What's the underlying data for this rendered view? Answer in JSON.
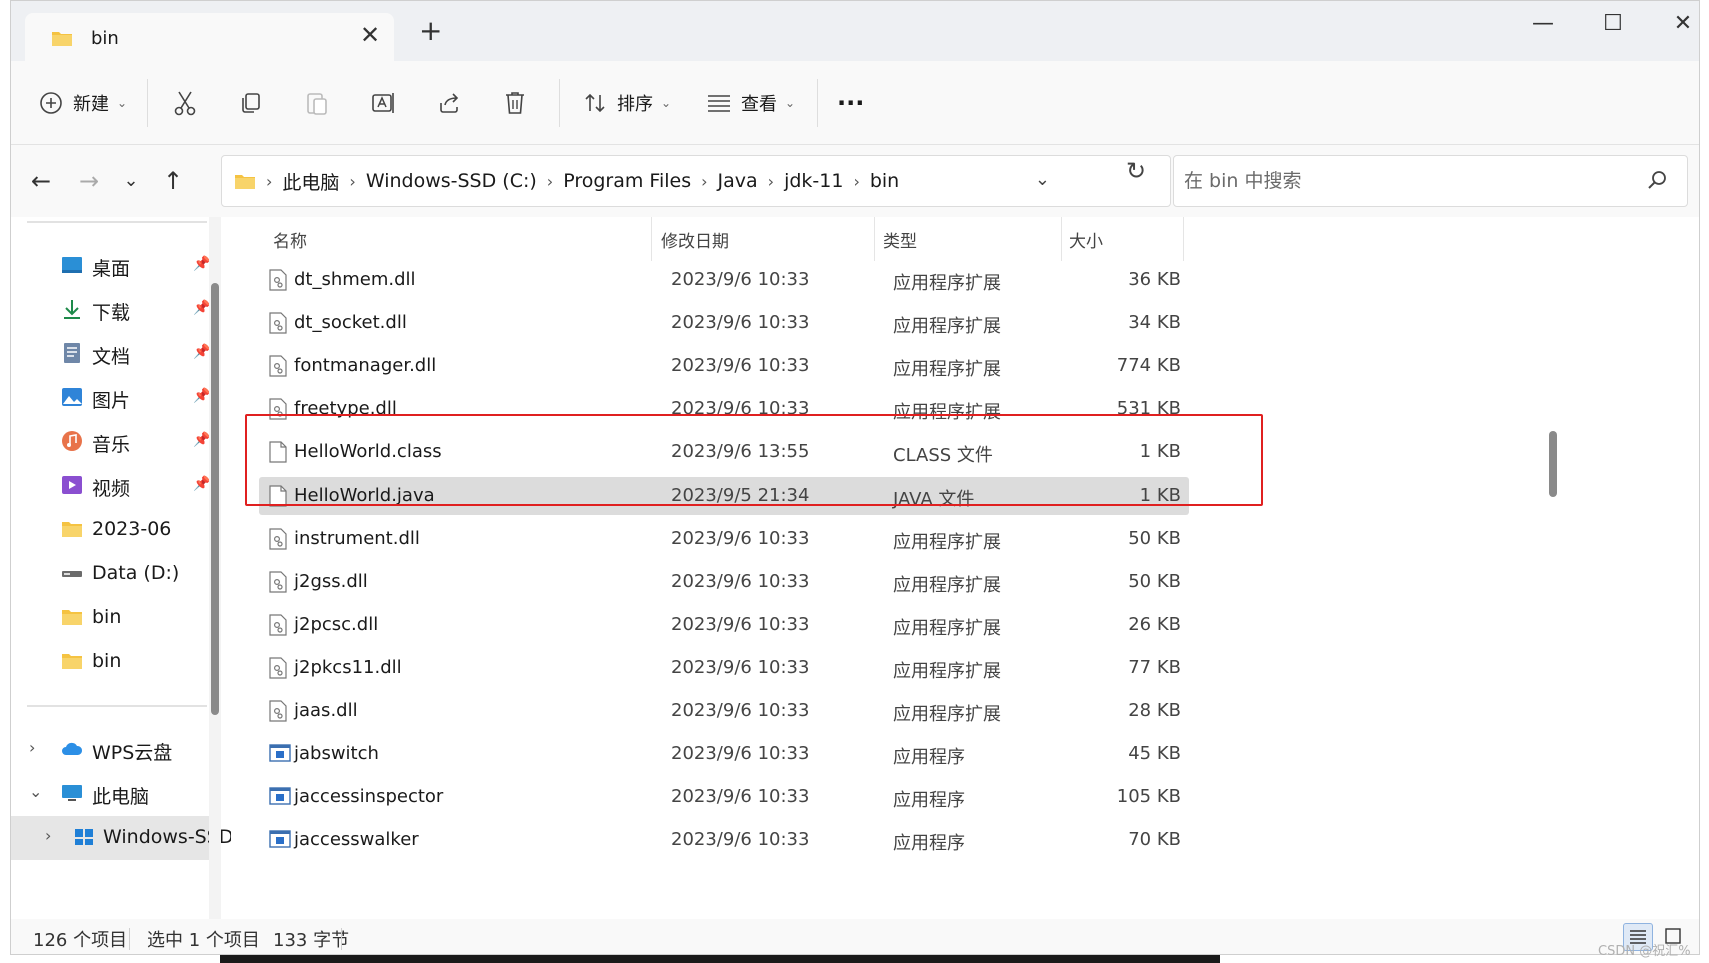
{
  "window": {
    "tab_title": "bin",
    "tab_close": "✕",
    "new_tab": "+",
    "minimize": "—",
    "maximize": "☐",
    "close": "✕"
  },
  "toolbar": {
    "new_label": "新建",
    "sort_label": "排序",
    "view_label": "查看",
    "more": "···"
  },
  "address": {
    "crumbs": [
      "此电脑",
      "Windows-SSD (C:)",
      "Program Files",
      "Java",
      "jdk-11",
      "bin"
    ],
    "search_placeholder": "在 bin 中搜索"
  },
  "sidebar": {
    "quick": [
      {
        "label": "桌面",
        "icon": "desktop-icon",
        "pinned": true
      },
      {
        "label": "下载",
        "icon": "download-icon",
        "pinned": true
      },
      {
        "label": "文档",
        "icon": "document-icon",
        "pinned": true
      },
      {
        "label": "图片",
        "icon": "picture-icon",
        "pinned": true
      },
      {
        "label": "音乐",
        "icon": "music-icon",
        "pinned": true
      },
      {
        "label": "视频",
        "icon": "video-icon",
        "pinned": true
      },
      {
        "label": "2023-06",
        "icon": "folder-icon",
        "pinned": false
      },
      {
        "label": "Data (D:)",
        "icon": "drive-icon",
        "pinned": false
      },
      {
        "label": "bin",
        "icon": "folder-icon",
        "pinned": false
      },
      {
        "label": "bin",
        "icon": "folder-icon",
        "pinned": false
      }
    ],
    "tree": [
      {
        "label": "WPS云盘",
        "icon": "cloud-icon",
        "expander": "›"
      },
      {
        "label": "此电脑",
        "icon": "computer-icon",
        "expander": "⌄"
      },
      {
        "label": "Windows-SSD",
        "icon": "windows-drive-icon",
        "expander": "›"
      }
    ]
  },
  "columns": {
    "name": "名称",
    "date": "修改日期",
    "type": "类型",
    "size": "大小"
  },
  "files": [
    {
      "name": "dt_shmem.dll",
      "date": "2023/9/6 10:33",
      "type": "应用程序扩展",
      "size": "36 KB",
      "kind": "dll"
    },
    {
      "name": "dt_socket.dll",
      "date": "2023/9/6 10:33",
      "type": "应用程序扩展",
      "size": "34 KB",
      "kind": "dll"
    },
    {
      "name": "fontmanager.dll",
      "date": "2023/9/6 10:33",
      "type": "应用程序扩展",
      "size": "774 KB",
      "kind": "dll"
    },
    {
      "name": "freetype.dll",
      "date": "2023/9/6 10:33",
      "type": "应用程序扩展",
      "size": "531 KB",
      "kind": "dll"
    },
    {
      "name": "HelloWorld.class",
      "date": "2023/9/6 13:55",
      "type": "CLASS 文件",
      "size": "1 KB",
      "kind": "file"
    },
    {
      "name": "HelloWorld.java",
      "date": "2023/9/5 21:34",
      "type": "JAVA 文件",
      "size": "1 KB",
      "kind": "file",
      "selected": true
    },
    {
      "name": "instrument.dll",
      "date": "2023/9/6 10:33",
      "type": "应用程序扩展",
      "size": "50 KB",
      "kind": "dll"
    },
    {
      "name": "j2gss.dll",
      "date": "2023/9/6 10:33",
      "type": "应用程序扩展",
      "size": "50 KB",
      "kind": "dll"
    },
    {
      "name": "j2pcsc.dll",
      "date": "2023/9/6 10:33",
      "type": "应用程序扩展",
      "size": "26 KB",
      "kind": "dll"
    },
    {
      "name": "j2pkcs11.dll",
      "date": "2023/9/6 10:33",
      "type": "应用程序扩展",
      "size": "77 KB",
      "kind": "dll"
    },
    {
      "name": "jaas.dll",
      "date": "2023/9/6 10:33",
      "type": "应用程序扩展",
      "size": "28 KB",
      "kind": "dll"
    },
    {
      "name": "jabswitch",
      "date": "2023/9/6 10:33",
      "type": "应用程序",
      "size": "45 KB",
      "kind": "exe"
    },
    {
      "name": "jaccessinspector",
      "date": "2023/9/6 10:33",
      "type": "应用程序",
      "size": "105 KB",
      "kind": "exe"
    },
    {
      "name": "jaccesswalker",
      "date": "2023/9/6 10:33",
      "type": "应用程序",
      "size": "70 KB",
      "kind": "exe"
    }
  ],
  "status": {
    "count": "126 个项目",
    "selection": "选中 1 个项目",
    "bytes": "133 字节"
  },
  "watermark": "CSDN @祝汇%",
  "colors": {
    "accent": "#0067c0",
    "folder": "#f5c342",
    "highlight": "#e02020",
    "selected_row": "#dcdcdc"
  }
}
